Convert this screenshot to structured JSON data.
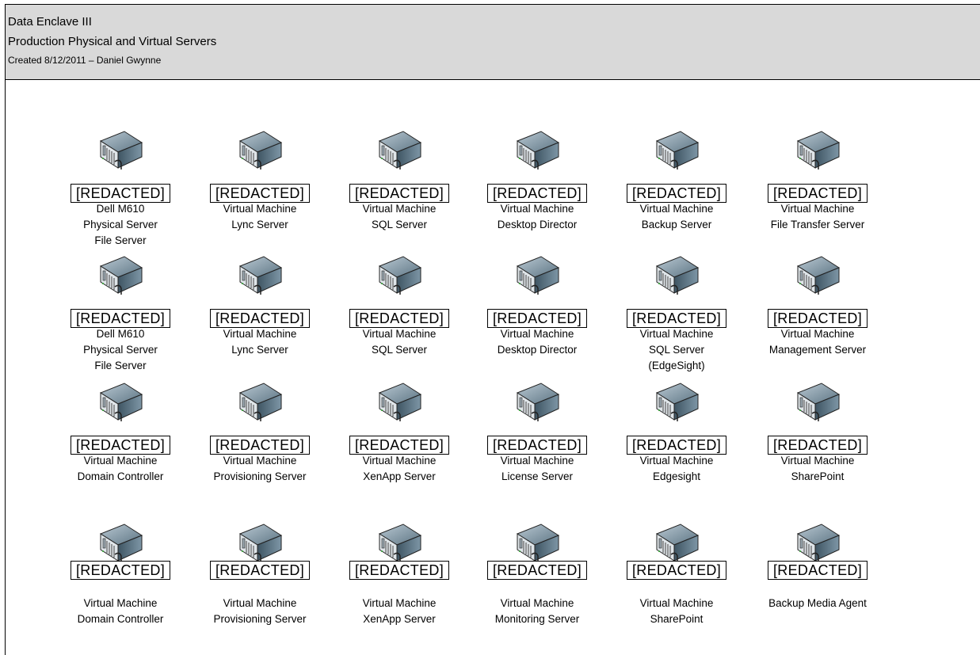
{
  "header": {
    "title": "Data Enclave III",
    "subtitle": "Production Physical and Virtual Servers",
    "created": "Created 8/12/2011 – Daniel Gwynne"
  },
  "servers": [
    {
      "label": "[REDACTED]",
      "lines": [
        "Dell M610",
        "Physical Server",
        "File Server"
      ]
    },
    {
      "label": "[REDACTED]",
      "lines": [
        "Virtual Machine",
        "Lync Server"
      ]
    },
    {
      "label": "[REDACTED]",
      "lines": [
        "Virtual Machine",
        "SQL Server"
      ]
    },
    {
      "label": "[REDACTED]",
      "lines": [
        "Virtual Machine",
        "Desktop Director"
      ]
    },
    {
      "label": "[REDACTED]",
      "lines": [
        "Virtual Machine",
        "Backup Server"
      ]
    },
    {
      "label": "[REDACTED]",
      "lines": [
        "Virtual Machine",
        "File Transfer Server"
      ]
    },
    {
      "label": "[REDACTED]",
      "lines": [
        "Dell M610",
        "Physical Server",
        "File Server"
      ]
    },
    {
      "label": "[REDACTED]",
      "lines": [
        "Virtual Machine",
        "Lync Server"
      ]
    },
    {
      "label": "[REDACTED]",
      "lines": [
        "Virtual Machine",
        "SQL Server"
      ]
    },
    {
      "label": "[REDACTED]",
      "lines": [
        "Virtual Machine",
        "Desktop Director"
      ]
    },
    {
      "label": "[REDACTED]",
      "lines": [
        "Virtual Machine",
        "SQL Server",
        "(EdgeSight)"
      ]
    },
    {
      "label": "[REDACTED]",
      "lines": [
        "Virtual Machine",
        "Management Server"
      ]
    },
    {
      "label": "[REDACTED]",
      "lines": [
        "Virtual Machine",
        "Domain Controller"
      ]
    },
    {
      "label": "[REDACTED]",
      "lines": [
        "Virtual Machine",
        "Provisioning Server"
      ]
    },
    {
      "label": "[REDACTED]",
      "lines": [
        "Virtual Machine",
        "XenApp Server"
      ]
    },
    {
      "label": "[REDACTED]",
      "lines": [
        "Virtual Machine",
        "License Server"
      ]
    },
    {
      "label": "[REDACTED]",
      "lines": [
        "Virtual Machine",
        "Edgesight"
      ]
    },
    {
      "label": "[REDACTED]",
      "lines": [
        "Virtual Machine",
        "SharePoint"
      ]
    },
    {
      "label": "[REDACTED]",
      "lines": [
        "Virtual Machine",
        "Domain Controller"
      ]
    },
    {
      "label": "[REDACTED]",
      "lines": [
        "Virtual Machine",
        "Provisioning Server"
      ]
    },
    {
      "label": "[REDACTED]",
      "lines": [
        "Virtual Machine",
        "XenApp Server"
      ]
    },
    {
      "label": "[REDACTED]",
      "lines": [
        "Virtual Machine",
        "Monitoring Server"
      ]
    },
    {
      "label": "[REDACTED]",
      "lines": [
        "Virtual Machine",
        "SharePoint"
      ]
    },
    {
      "label": "[REDACTED]",
      "lines": [
        "Backup Media Agent"
      ]
    }
  ]
}
